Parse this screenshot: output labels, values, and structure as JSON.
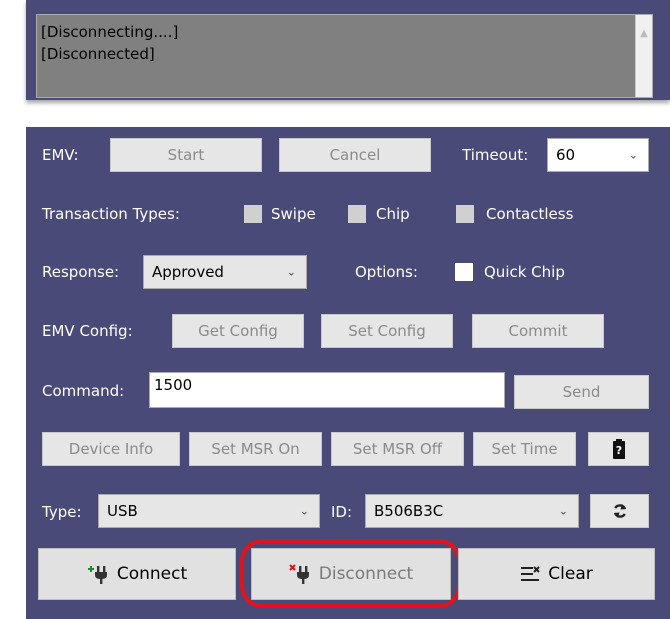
{
  "log": {
    "lines": [
      "[Disconnecting....]",
      "[Disconnected]"
    ]
  },
  "emv": {
    "label": "EMV:",
    "start_label": "Start",
    "cancel_label": "Cancel",
    "timeout_label": "Timeout:",
    "timeout_value": "60"
  },
  "transaction_types": {
    "label": "Transaction Types:",
    "swipe_label": "Swipe",
    "chip_label": "Chip",
    "contactless_label": "Contactless"
  },
  "response": {
    "label": "Response:",
    "value": "Approved",
    "options_label": "Options:",
    "quick_chip_label": "Quick Chip"
  },
  "emv_config": {
    "label": "EMV Config:",
    "get_label": "Get Config",
    "set_label": "Set Config",
    "commit_label": "Commit"
  },
  "command": {
    "label": "Command:",
    "value": "1500",
    "send_label": "Send"
  },
  "device_buttons": {
    "device_info": "Device Info",
    "set_msr_on": "Set MSR On",
    "set_msr_off": "Set MSR Off",
    "set_time": "Set Time"
  },
  "connection": {
    "type_label": "Type:",
    "type_value": "USB",
    "id_label": "ID:",
    "id_value": "B506B3C"
  },
  "actions": {
    "connect_label": "Connect",
    "disconnect_label": "Disconnect",
    "clear_label": "Clear"
  },
  "colors": {
    "panel_bg": "#4a4a78",
    "highlight": "#e0141e"
  }
}
